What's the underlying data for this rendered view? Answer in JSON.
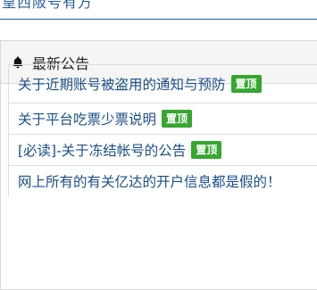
{
  "header": {
    "partial_text": "皇西阪号有方"
  },
  "announcements": {
    "title": "最新公告",
    "icon": "bell-icon",
    "items": [
      {
        "text": "关于近期账号被盗用的通知与预防",
        "badge": "置顶"
      },
      {
        "text": "关于平台吃票少票说明",
        "badge": "置顶"
      },
      {
        "text": "[必读]-关于冻结帐号的公告",
        "badge": "置顶"
      },
      {
        "text": "网上所有的有关亿达的开户信息都是假的！"
      }
    ]
  },
  "colors": {
    "link": "#1a4f86",
    "badge": "#36a631",
    "header_bg": "#f5f5f5"
  }
}
